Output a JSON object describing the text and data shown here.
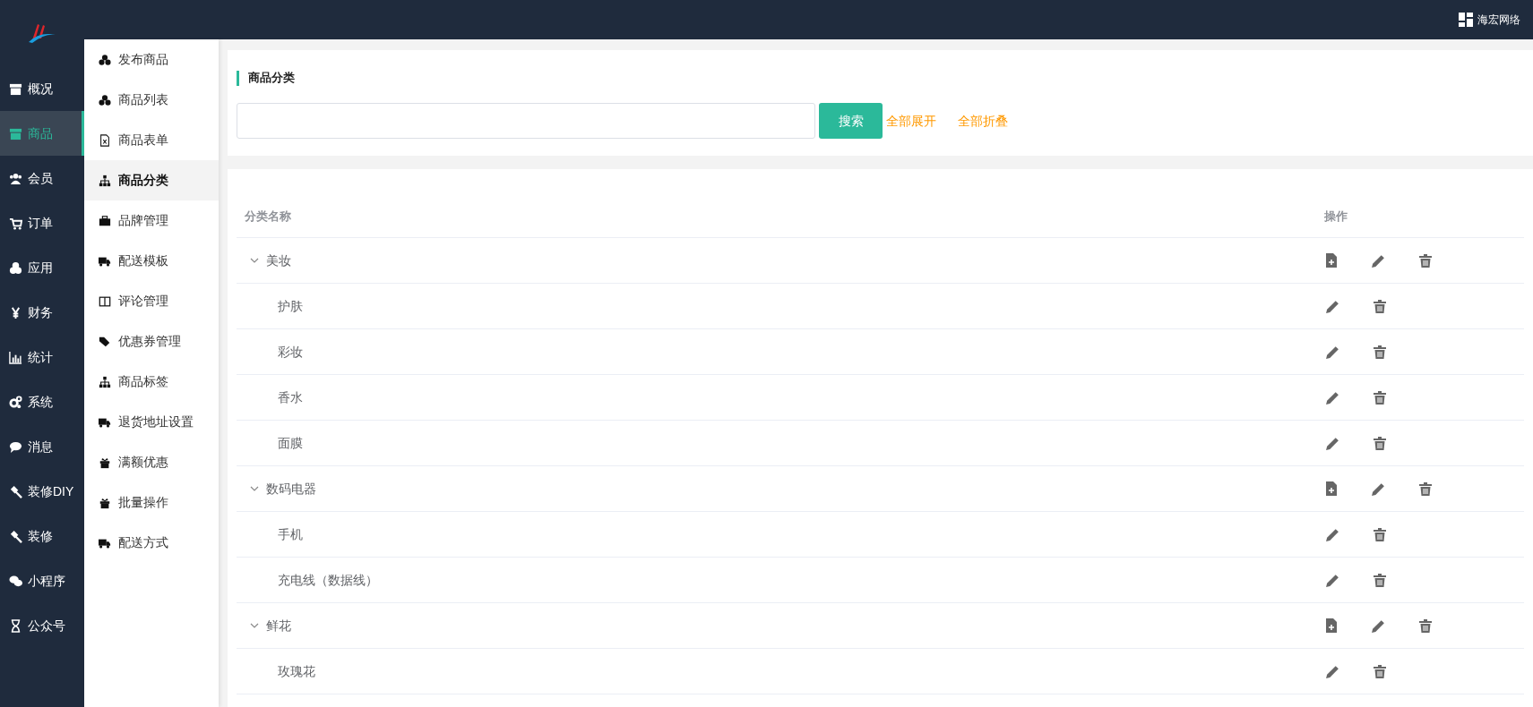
{
  "topbar": {
    "user": "海宏网络"
  },
  "main_nav": [
    {
      "label": "概况",
      "selected": false
    },
    {
      "label": "商品",
      "selected": true
    },
    {
      "label": "会员",
      "selected": false
    },
    {
      "label": "订单",
      "selected": false
    },
    {
      "label": "应用",
      "selected": false
    },
    {
      "label": "财务",
      "selected": false
    },
    {
      "label": "统计",
      "selected": false
    },
    {
      "label": "系统",
      "selected": false
    },
    {
      "label": "消息",
      "selected": false
    },
    {
      "label": "装修DIY",
      "selected": false
    },
    {
      "label": "装修",
      "selected": false
    },
    {
      "label": "小程序",
      "selected": false
    },
    {
      "label": "公众号",
      "selected": false
    }
  ],
  "sub_nav": [
    {
      "label": "发布商品",
      "selected": false
    },
    {
      "label": "商品列表",
      "selected": false
    },
    {
      "label": "商品表单",
      "selected": false
    },
    {
      "label": "商品分类",
      "selected": true
    },
    {
      "label": "品牌管理",
      "selected": false
    },
    {
      "label": "配送模板",
      "selected": false
    },
    {
      "label": "评论管理",
      "selected": false
    },
    {
      "label": "优惠券管理",
      "selected": false
    },
    {
      "label": "商品标签",
      "selected": false
    },
    {
      "label": "退货地址设置",
      "selected": false
    },
    {
      "label": "满额优惠",
      "selected": false
    },
    {
      "label": "批量操作",
      "selected": false
    },
    {
      "label": "配送方式",
      "selected": false
    }
  ],
  "panel": {
    "title": "商品分类",
    "search_button": "搜索",
    "expand_all": "全部展开",
    "collapse_all": "全部折叠"
  },
  "table": {
    "columns": [
      "分类名称",
      "操作"
    ],
    "rows": [
      {
        "name": "美妆",
        "expanded": true,
        "children": [
          {
            "name": "护肤"
          },
          {
            "name": "彩妆"
          },
          {
            "name": "香水"
          },
          {
            "name": "面膜"
          }
        ]
      },
      {
        "name": "数码电器",
        "expanded": true,
        "children": [
          {
            "name": "手机"
          },
          {
            "name": "充电线（数据线）"
          }
        ]
      },
      {
        "name": "鲜花",
        "expanded": true,
        "children": [
          {
            "name": "玫瑰花"
          }
        ]
      }
    ]
  }
}
